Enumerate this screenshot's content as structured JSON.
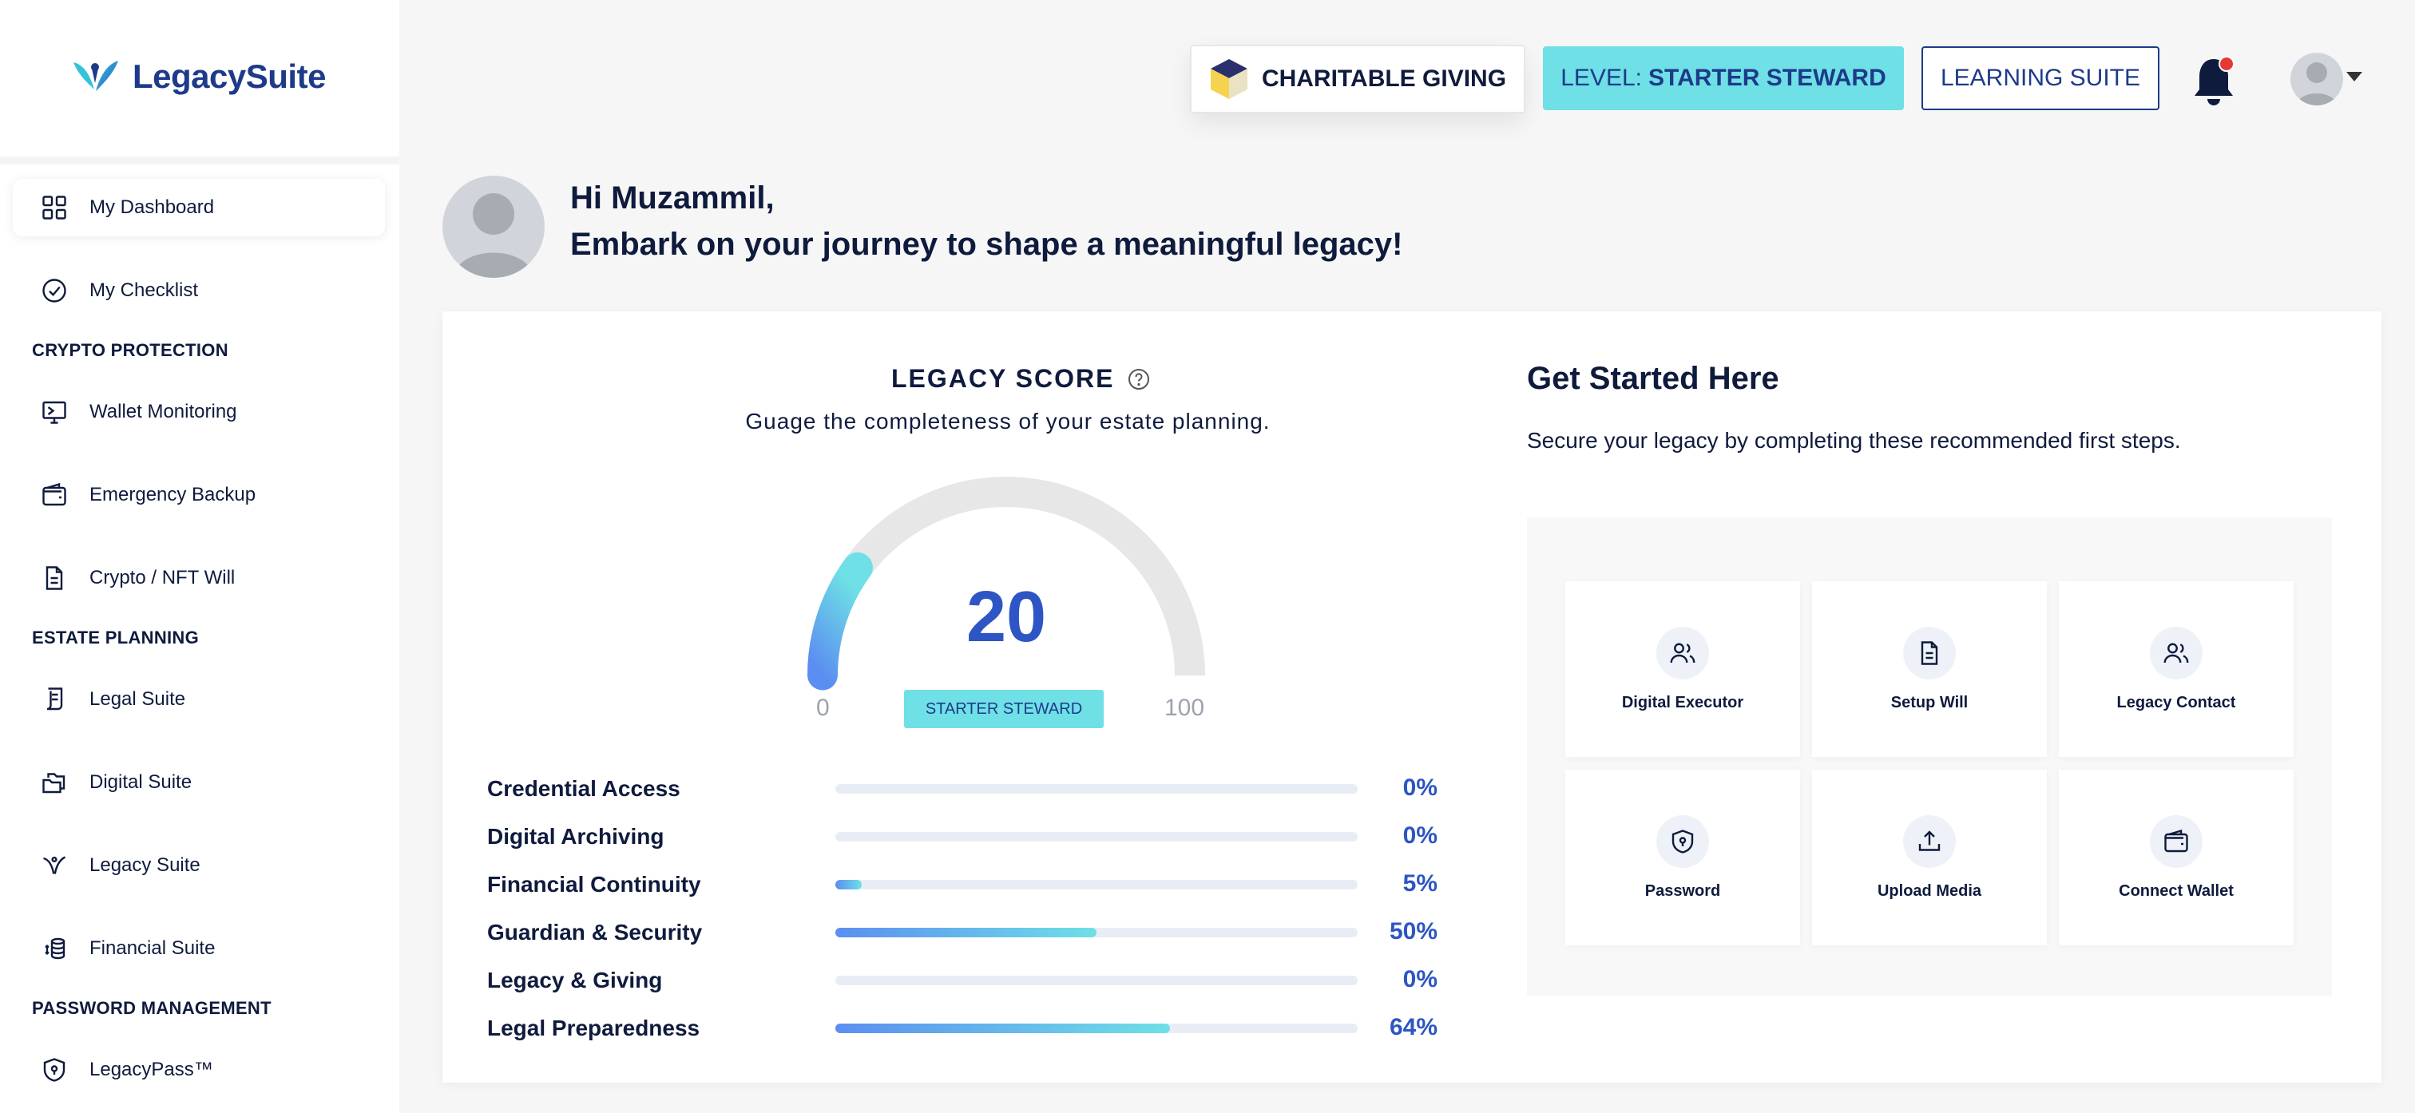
{
  "brand": {
    "name": "LegacySuite"
  },
  "sidebar": {
    "items": [
      {
        "label": "My Dashboard",
        "icon": "grid-icon"
      },
      {
        "label": "My Checklist",
        "icon": "check-circle-icon"
      },
      {
        "label": "Wallet Monitoring",
        "icon": "monitor-icon"
      },
      {
        "label": "Emergency Backup",
        "icon": "wallet-icon"
      },
      {
        "label": "Crypto / NFT Will",
        "icon": "document-icon"
      },
      {
        "label": "Legal Suite",
        "icon": "scroll-icon"
      },
      {
        "label": "Digital Suite",
        "icon": "folders-icon"
      },
      {
        "label": "Legacy Suite",
        "icon": "bird-icon"
      },
      {
        "label": "Financial Suite",
        "icon": "coins-icon"
      },
      {
        "label": "LegacyPass™",
        "icon": "shield-icon"
      }
    ],
    "sections": {
      "crypto": "CRYPTO PROTECTION",
      "estate": "ESTATE PLANNING",
      "password": "PASSWORD MANAGEMENT"
    }
  },
  "header": {
    "charitable_label": "CHARITABLE GIVING",
    "level_prefix": "LEVEL:",
    "level_value": "STARTER STEWARD",
    "learning_label": "LEARNING SUITE",
    "colors": {
      "accent": "#6ee0e6",
      "brand": "#1e3a8a",
      "notification": "#e53935"
    }
  },
  "greeting": {
    "line1": "Hi Muzammil,",
    "line2": "Embark on your journey to shape a meaningful legacy!"
  },
  "score": {
    "title": "LEGACY SCORE",
    "subtitle": "Guage the completeness of your estate planning.",
    "value": "20",
    "value_fraction": 0.2,
    "min": "0",
    "max": "100",
    "badge": "STARTER STEWARD",
    "categories": [
      {
        "label": "Credential Access",
        "pct": "0%",
        "value": 0
      },
      {
        "label": "Digital Archiving",
        "pct": "0%",
        "value": 0
      },
      {
        "label": "Financial Continuity",
        "pct": "5%",
        "value": 5
      },
      {
        "label": "Guardian & Security",
        "pct": "50%",
        "value": 50
      },
      {
        "label": "Legacy & Giving",
        "pct": "0%",
        "value": 0
      },
      {
        "label": "Legal Preparedness",
        "pct": "64%",
        "value": 64
      }
    ]
  },
  "get_started": {
    "title": "Get Started Here",
    "subtitle": "Secure your legacy by completing these recommended first steps.",
    "tiles": [
      {
        "label": "Digital Executor",
        "icon": "users-icon"
      },
      {
        "label": "Setup Will",
        "icon": "document-icon"
      },
      {
        "label": "Legacy Contact",
        "icon": "users-icon"
      },
      {
        "label": "Password",
        "icon": "shield-icon"
      },
      {
        "label": "Upload Media",
        "icon": "upload-icon"
      },
      {
        "label": "Connect Wallet",
        "icon": "wallet-icon"
      }
    ]
  }
}
